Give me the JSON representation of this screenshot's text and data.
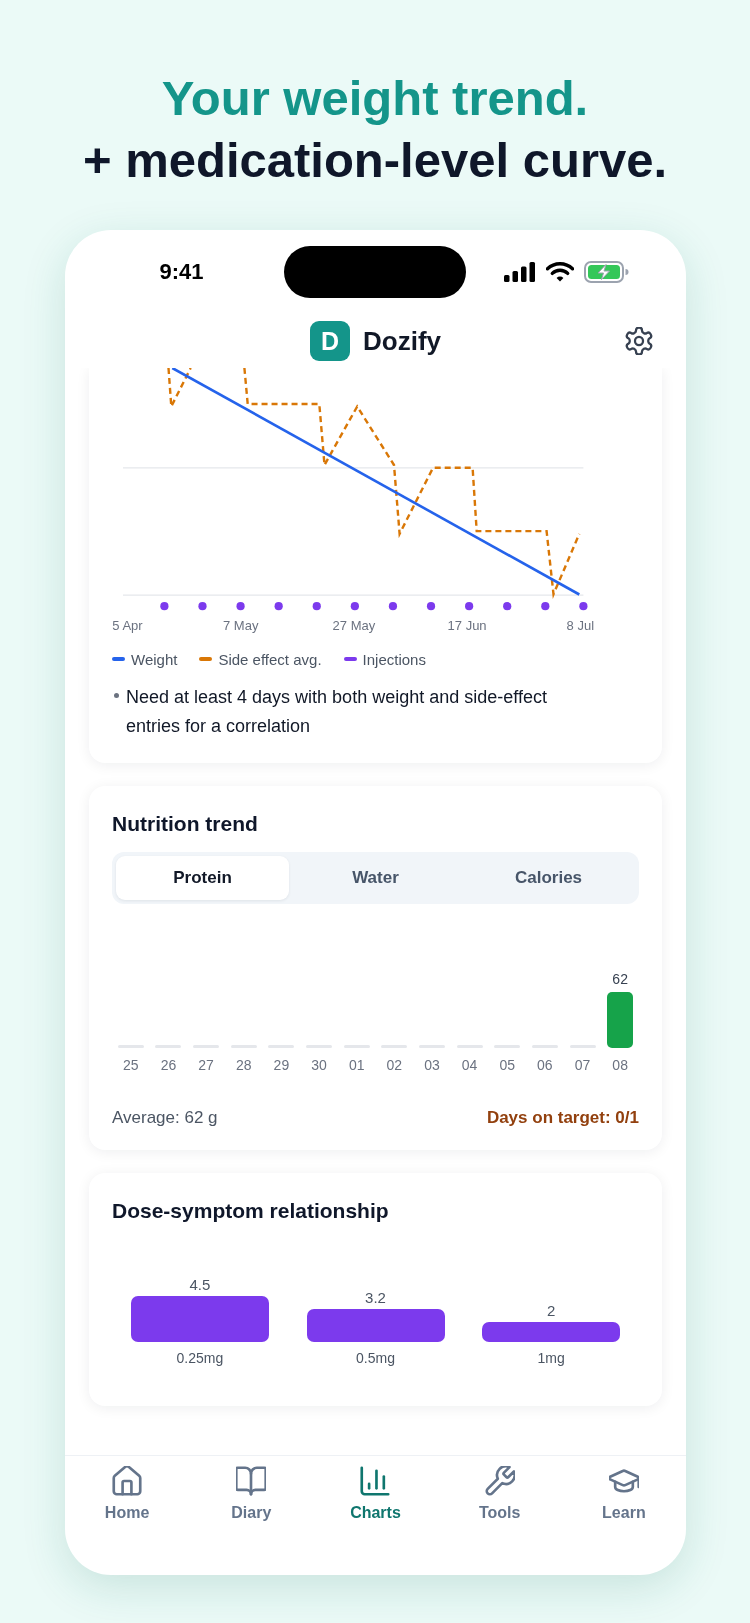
{
  "headline": {
    "line_1": "Your weight trend.",
    "line_2": "+ medication-level curve."
  },
  "status_bar": {
    "time": "9:41"
  },
  "app_header": {
    "logo_letter": "D",
    "title": "Dozify"
  },
  "correlation_card": {
    "x_axis_labels": [
      "5 Apr",
      "7 May",
      "27 May",
      "17 Jun",
      "8 Jul"
    ],
    "legend": [
      {
        "label": "Weight",
        "color": "#2563eb"
      },
      {
        "label": "Side effect avg.",
        "color": "#d97706"
      },
      {
        "label": "Injections",
        "color": "#7c3aed"
      }
    ],
    "note": "Need at least 4 days with both weight and side-effect entries for a correlation"
  },
  "nutrition_card": {
    "title": "Nutrition trend",
    "tabs": [
      {
        "label": "Protein",
        "selected": true
      },
      {
        "label": "Water",
        "selected": false
      },
      {
        "label": "Calories",
        "selected": false
      }
    ],
    "chart_data": {
      "type": "bar",
      "categories": [
        "25",
        "26",
        "27",
        "28",
        "29",
        "30",
        "01",
        "02",
        "03",
        "04",
        "05",
        "06",
        "07",
        "08"
      ],
      "values": [
        null,
        null,
        null,
        null,
        null,
        null,
        null,
        null,
        null,
        null,
        null,
        null,
        null,
        62
      ],
      "data_labels": true
    },
    "average": "Average: 62 g",
    "days_on_target": "Days on target: 0/1"
  },
  "dose_card": {
    "title": "Dose-symptom relationship",
    "chart_data": {
      "type": "bar",
      "categories": [
        "0.25mg",
        "0.5mg",
        "1mg"
      ],
      "values": [
        4.5,
        3.2,
        2
      ],
      "data_labels": true
    }
  },
  "bottom_nav": [
    {
      "label": "Home",
      "selected": false
    },
    {
      "label": "Diary",
      "selected": false
    },
    {
      "label": "Charts",
      "selected": true
    },
    {
      "label": "Tools",
      "selected": false
    },
    {
      "label": "Learn",
      "selected": false
    }
  ]
}
